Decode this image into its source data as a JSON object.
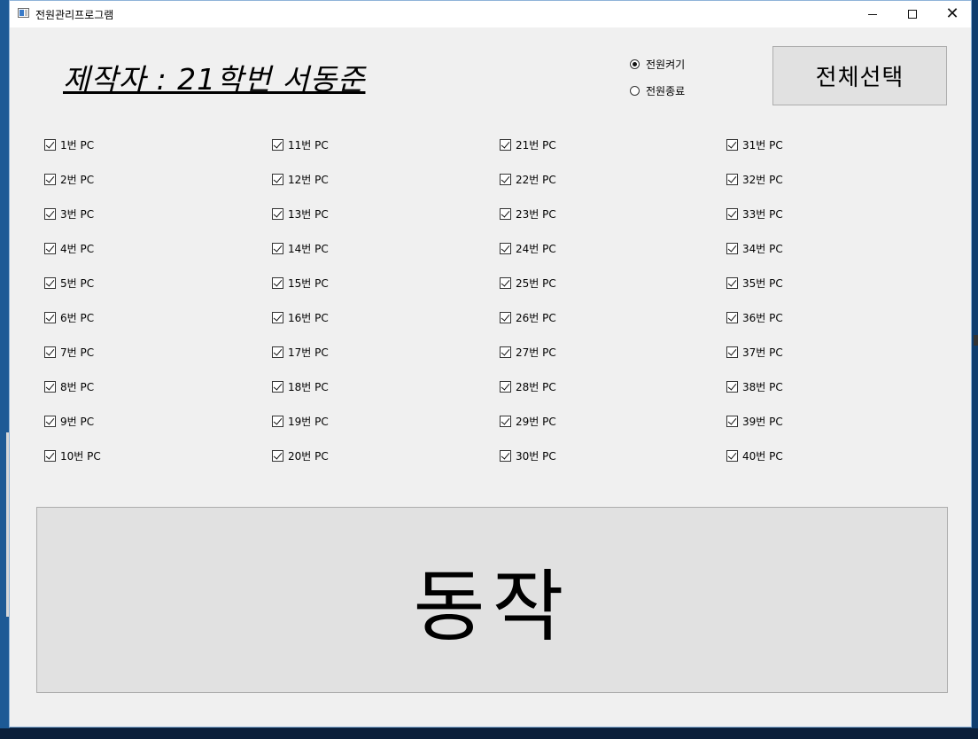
{
  "window": {
    "title": "전원관리프로그램"
  },
  "header": {
    "author_label": "제작자 : 21학번 서동준"
  },
  "power_options": [
    {
      "label": "전원켜기",
      "checked": true
    },
    {
      "label": "전원종료",
      "checked": false
    }
  ],
  "select_all_label": "전체선택",
  "pcs": [
    {
      "label": "1번 PC",
      "checked": true
    },
    {
      "label": "2번 PC",
      "checked": true
    },
    {
      "label": "3번 PC",
      "checked": true
    },
    {
      "label": "4번 PC",
      "checked": true
    },
    {
      "label": "5번 PC",
      "checked": true
    },
    {
      "label": "6번 PC",
      "checked": true
    },
    {
      "label": "7번 PC",
      "checked": true
    },
    {
      "label": "8번 PC",
      "checked": true
    },
    {
      "label": "9번 PC",
      "checked": true
    },
    {
      "label": "10번 PC",
      "checked": true
    },
    {
      "label": "11번 PC",
      "checked": true
    },
    {
      "label": "12번 PC",
      "checked": true
    },
    {
      "label": "13번 PC",
      "checked": true
    },
    {
      "label": "14번 PC",
      "checked": true
    },
    {
      "label": "15번 PC",
      "checked": true
    },
    {
      "label": "16번 PC",
      "checked": true
    },
    {
      "label": "17번 PC",
      "checked": true
    },
    {
      "label": "18번 PC",
      "checked": true
    },
    {
      "label": "19번 PC",
      "checked": true
    },
    {
      "label": "20번 PC",
      "checked": true
    },
    {
      "label": "21번 PC",
      "checked": true
    },
    {
      "label": "22번 PC",
      "checked": true
    },
    {
      "label": "23번 PC",
      "checked": true
    },
    {
      "label": "24번 PC",
      "checked": true
    },
    {
      "label": "25번 PC",
      "checked": true
    },
    {
      "label": "26번 PC",
      "checked": true
    },
    {
      "label": "27번 PC",
      "checked": true
    },
    {
      "label": "28번 PC",
      "checked": true
    },
    {
      "label": "29번 PC",
      "checked": true
    },
    {
      "label": "30번 PC",
      "checked": true
    },
    {
      "label": "31번 PC",
      "checked": true
    },
    {
      "label": "32번 PC",
      "checked": true
    },
    {
      "label": "33번 PC",
      "checked": true
    },
    {
      "label": "34번 PC",
      "checked": true
    },
    {
      "label": "35번 PC",
      "checked": true
    },
    {
      "label": "36번 PC",
      "checked": true
    },
    {
      "label": "37번 PC",
      "checked": true
    },
    {
      "label": "38번 PC",
      "checked": true
    },
    {
      "label": "39번 PC",
      "checked": true
    },
    {
      "label": "40번 PC",
      "checked": true
    }
  ],
  "action_label": "동작"
}
